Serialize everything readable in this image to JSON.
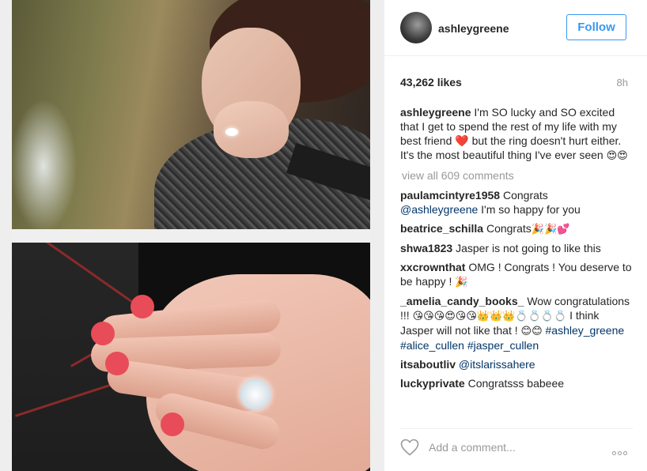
{
  "post": {
    "username": "ashleygreene",
    "follow_label": "Follow",
    "likes": "43,262 likes",
    "time": "8h",
    "caption": {
      "author": "ashleygreene",
      "text_1": "I'm SO lucky and SO excited that I get to spend the rest of my life with my best friend",
      "heart": "❤️",
      "text_2": "but the ring doesn't hurt either. It's the most beautiful thing I've ever seen",
      "emoji": "😍😍"
    },
    "view_all": "view all 609 comments"
  },
  "comments": [
    {
      "author": "paulamcintyre1958",
      "text": "Congrats",
      "mention": "@ashleygreene",
      "text_after": "I'm so happy for you"
    },
    {
      "author": "beatrice_schilla",
      "text": "Congrats",
      "emoji": "🎉🎉💕"
    },
    {
      "author": "shwa1823",
      "text": "Jasper is not going to like this"
    },
    {
      "author": "xxcrownthat",
      "text": "OMG ! Congrats ! You deserve to be happy !",
      "emoji": "🎉"
    },
    {
      "author": "_amelia_candy_books_",
      "text": "Wow congratulations !!!",
      "emoji": "😘😘😘😍😘😘👑👑👑💍💍💍💍",
      "text_2": "I think Jasper will not like that !",
      "emoji_2": "😊😊",
      "tag_1": "#ashley_greene",
      "tag_2": "#alice_cullen",
      "tag_3": "#jasper_cullen"
    },
    {
      "author": "itsaboutliv",
      "mention": "@itslarissahere"
    },
    {
      "author": "luckyprivate",
      "text": "Congratsss babeee"
    }
  ],
  "footer": {
    "comment_placeholder": "Add a comment...",
    "like_icon": "heart-outline-icon",
    "more_icon": "more-options-icon"
  },
  "colors": {
    "accent": "#3897f0",
    "link": "#003569",
    "muted": "#999999",
    "text": "#262626"
  }
}
